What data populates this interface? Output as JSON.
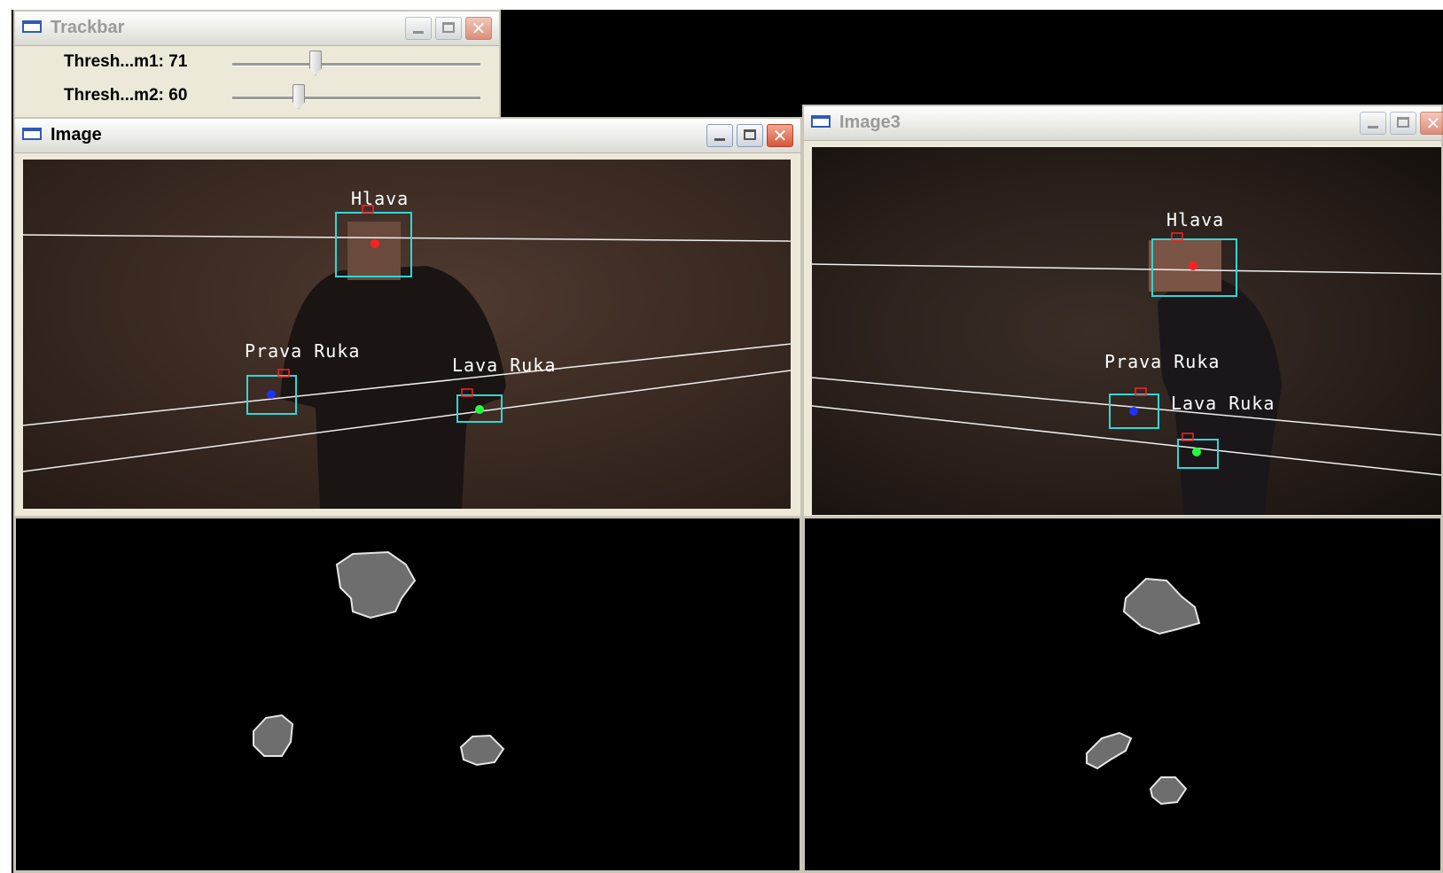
{
  "trackbar_window": {
    "title": "Trackbar",
    "sliders": [
      {
        "label": "Thresh...m1: 71",
        "value": 71
      },
      {
        "label": "Thresh...m2: 60",
        "value": 60
      }
    ]
  },
  "image_window": {
    "title": "Image",
    "labels": {
      "head": "Hlava",
      "right_hand": "Prava Ruka",
      "left_hand": "Lava Ruka"
    }
  },
  "image3_window": {
    "title": "Image3",
    "labels": {
      "head": "Hlava",
      "right_hand": "Prava Ruka",
      "left_hand": "Lava Ruka"
    }
  },
  "colors": {
    "bounding_box": "#33d6d6",
    "head_marker": "#ff2020",
    "right_hand_marker": "#2030ff",
    "left_hand_marker": "#20ff40",
    "blob_fill": "#6e6e6e",
    "blob_outline": "#e6e6e6"
  },
  "icons": {
    "window": "window-icon",
    "minimize": "minimize-icon",
    "maximize": "maximize-icon",
    "close": "close-icon"
  }
}
